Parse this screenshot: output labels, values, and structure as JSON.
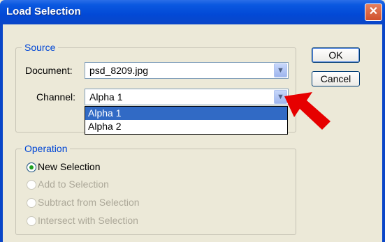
{
  "window": {
    "title": "Load Selection",
    "close_glyph": "✕"
  },
  "source": {
    "legend": "Source",
    "document_label": "Document:",
    "document_value": "psd_8209.jpg",
    "channel_label": "Channel:",
    "channel_value": "Alpha 1",
    "channel_options": [
      "Alpha 1",
      "Alpha 2"
    ]
  },
  "buttons": {
    "ok": "OK",
    "cancel": "Cancel"
  },
  "operation": {
    "legend": "Operation",
    "options": [
      "New Selection",
      "Add to Selection",
      "Subtract from Selection",
      "Intersect with Selection"
    ],
    "selected_index": 0
  },
  "colors": {
    "titlebar": "#0249d6",
    "legend": "#0046d5",
    "highlight": "#316ac5",
    "arrow": "#e60000"
  }
}
